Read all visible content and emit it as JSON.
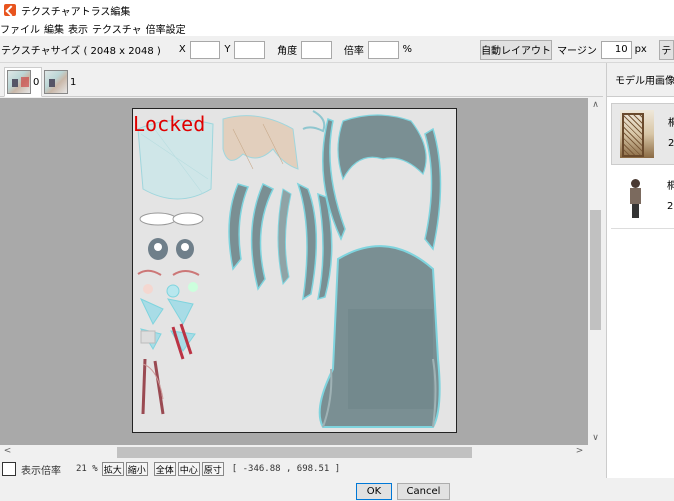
{
  "window": {
    "title": "テクスチャアトラス編集"
  },
  "menu": [
    "ファイル",
    "編集",
    "表示",
    "テクスチャ",
    "倍率設定"
  ],
  "toolbar": {
    "size_label": "テクスチャサイズ ( 2048 x 2048 )",
    "x_label": "X",
    "x_value": "",
    "y_label": "Y",
    "y_value": "",
    "angle_label": "角度",
    "angle_value": "",
    "scale_label": "倍率",
    "scale_value": "",
    "percent": "%",
    "auto_layout": "自動レイアウト",
    "margin_label": "マージン",
    "margin_value": "10",
    "px": "px",
    "extra_btn": "テ"
  },
  "tabs": [
    {
      "label": "0",
      "active": true
    },
    {
      "label": "1",
      "active": false
    }
  ],
  "canvas": {
    "locked_text": "Locked",
    "bg": "#a9a9a9",
    "texture_bg": "#e4e4e4"
  },
  "status": {
    "zoom_label": "表示倍率",
    "zoom_value": "21 %",
    "buttons": [
      "拡大",
      "縮小",
      "全体",
      "中心",
      "原寸"
    ],
    "coord": "[ -346.88 ,  698.51 ]"
  },
  "right": {
    "header": "モデル用画像リス",
    "items": [
      {
        "line1": "桐",
        "line2": "2"
      },
      {
        "line1": "桐",
        "line2": "2"
      }
    ]
  },
  "dialog": {
    "ok": "OK",
    "cancel": "Cancel"
  },
  "colors": {
    "accent": "#e8541e",
    "locked": "#e00000",
    "hair": "#7a8f93",
    "cyan": "#7fd4de"
  }
}
